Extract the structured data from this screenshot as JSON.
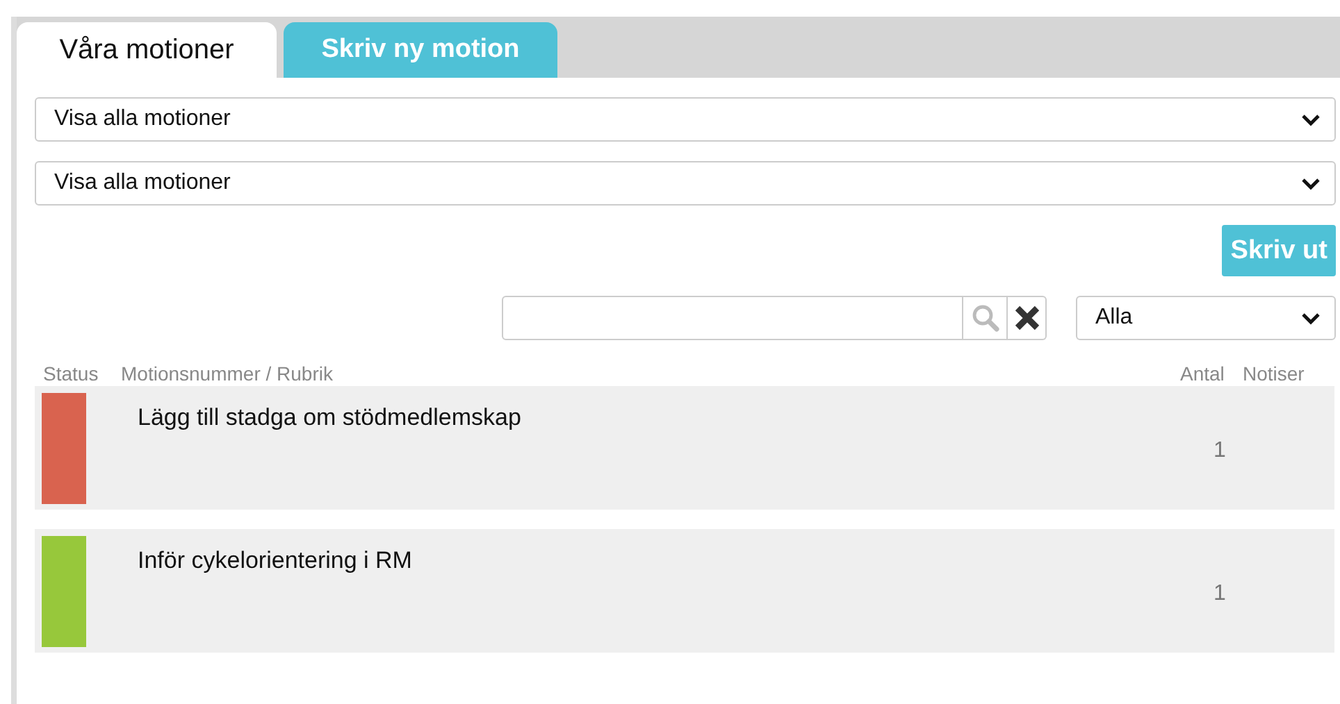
{
  "tabs": [
    {
      "label": "Våra motioner",
      "selected": true
    },
    {
      "label": "Skriv ny motion",
      "selected": false
    }
  ],
  "filters": [
    {
      "value": "Visa alla motioner"
    },
    {
      "value": "Visa alla motioner"
    }
  ],
  "print_button": "Skriv ut",
  "category_select": {
    "value": "Alla"
  },
  "table": {
    "columns": [
      "Status",
      "Motionsnummer / Rubrik",
      "Antal",
      "Notiser"
    ],
    "rows": [
      {
        "color": "#d9634f",
        "title": "Lägg till stadga om stödmedlemskap",
        "count": "1"
      },
      {
        "color": "#97c83b",
        "title": "Inför cykelorientering i RM",
        "count": "1"
      }
    ]
  }
}
